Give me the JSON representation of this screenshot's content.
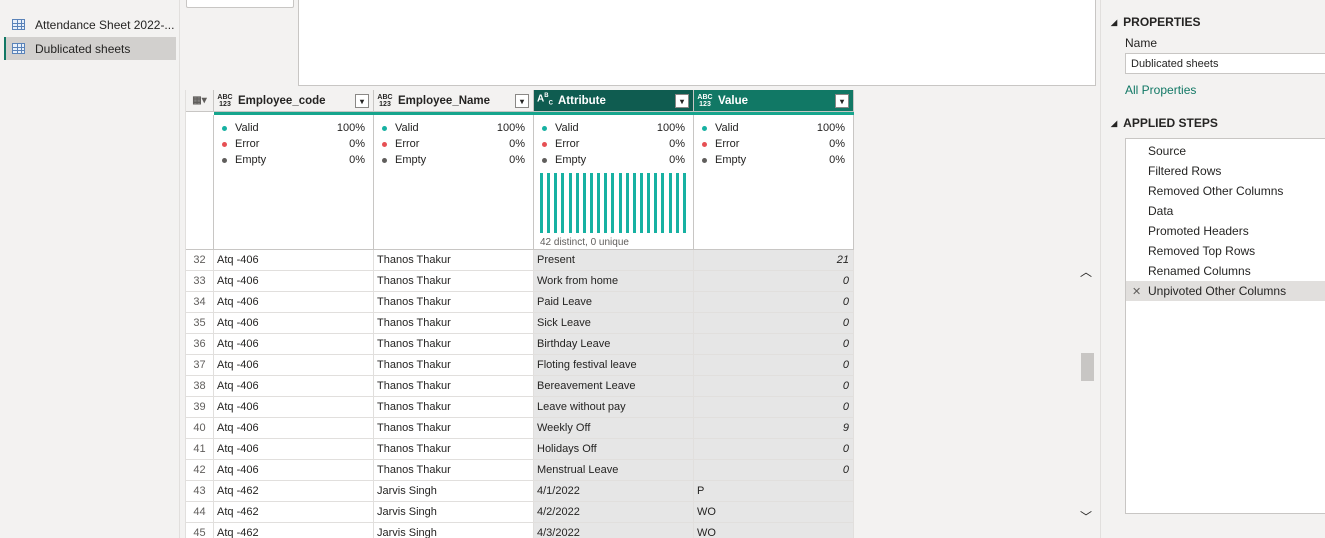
{
  "queries": [
    {
      "label": "Attendance Sheet 2022-...",
      "selected": false
    },
    {
      "label": "Dublicated sheets",
      "selected": true
    }
  ],
  "columns": [
    {
      "name": "Employee_code",
      "type": "ABC\n123",
      "profile": {
        "valid": "100%",
        "error": "0%",
        "empty": "0%"
      }
    },
    {
      "name": "Employee_Name",
      "type": "ABC\n123",
      "profile": {
        "valid": "100%",
        "error": "0%",
        "empty": "0%"
      }
    },
    {
      "name": "Attribute",
      "type": "A B C",
      "profile": {
        "valid": "100%",
        "error": "0%",
        "empty": "0%"
      },
      "distinct": "42 distinct, 0 unique"
    },
    {
      "name": "Value",
      "type": "ABC\n123",
      "profile": {
        "valid": "100%",
        "error": "0%",
        "empty": "0%"
      }
    }
  ],
  "profile_labels": {
    "valid": "Valid",
    "error": "Error",
    "empty": "Empty"
  },
  "colors": {
    "valid": "#17b1a2",
    "error": "#e65054",
    "empty": "#605e5c",
    "accent": "#117865"
  },
  "rows": [
    {
      "n": "32",
      "code": "Atq -406",
      "name": "Thanos Thakur",
      "attr": "Present",
      "value": "21",
      "numeric": true
    },
    {
      "n": "33",
      "code": "Atq -406",
      "name": "Thanos Thakur",
      "attr": "Work from home",
      "value": "0",
      "numeric": true
    },
    {
      "n": "34",
      "code": "Atq -406",
      "name": "Thanos Thakur",
      "attr": "Paid Leave",
      "value": "0",
      "numeric": true
    },
    {
      "n": "35",
      "code": "Atq -406",
      "name": "Thanos Thakur",
      "attr": "Sick Leave",
      "value": "0",
      "numeric": true
    },
    {
      "n": "36",
      "code": "Atq -406",
      "name": "Thanos Thakur",
      "attr": "Birthday Leave",
      "value": "0",
      "numeric": true
    },
    {
      "n": "37",
      "code": "Atq -406",
      "name": "Thanos Thakur",
      "attr": "Floting festival leave",
      "value": "0",
      "numeric": true
    },
    {
      "n": "38",
      "code": "Atq -406",
      "name": "Thanos Thakur",
      "attr": "Bereavement Leave",
      "value": "0",
      "numeric": true
    },
    {
      "n": "39",
      "code": "Atq -406",
      "name": "Thanos Thakur",
      "attr": "Leave without pay",
      "value": "0",
      "numeric": true
    },
    {
      "n": "40",
      "code": "Atq -406",
      "name": "Thanos Thakur",
      "attr": "Weekly Off",
      "value": "9",
      "numeric": true
    },
    {
      "n": "41",
      "code": "Atq -406",
      "name": "Thanos Thakur",
      "attr": "Holidays Off",
      "value": "0",
      "numeric": true
    },
    {
      "n": "42",
      "code": "Atq -406",
      "name": "Thanos Thakur",
      "attr": "Menstrual Leave",
      "value": "0",
      "numeric": true
    },
    {
      "n": "43",
      "code": "Atq -462",
      "name": "Jarvis Singh",
      "attr": "4/1/2022",
      "value": "P",
      "numeric": false
    },
    {
      "n": "44",
      "code": "Atq -462",
      "name": "Jarvis Singh",
      "attr": "4/2/2022",
      "value": "WO",
      "numeric": false
    },
    {
      "n": "45",
      "code": "Atq -462",
      "name": "Jarvis Singh",
      "attr": "4/3/2022",
      "value": "WO",
      "numeric": false
    }
  ],
  "properties": {
    "title": "PROPERTIES",
    "name_label": "Name",
    "name_value": "Dublicated sheets",
    "all_properties": "All Properties"
  },
  "applied_steps": {
    "title": "APPLIED STEPS",
    "steps": [
      {
        "label": "Source",
        "gear": true
      },
      {
        "label": "Filtered Rows",
        "gear": true
      },
      {
        "label": "Removed Other Columns",
        "gear": true
      },
      {
        "label": "Data",
        "gear": false
      },
      {
        "label": "Promoted Headers",
        "gear": true
      },
      {
        "label": "Removed Top Rows",
        "gear": true
      },
      {
        "label": "Renamed Columns",
        "gear": false
      },
      {
        "label": "Unpivoted Other Columns",
        "gear": false,
        "active": true
      }
    ]
  }
}
